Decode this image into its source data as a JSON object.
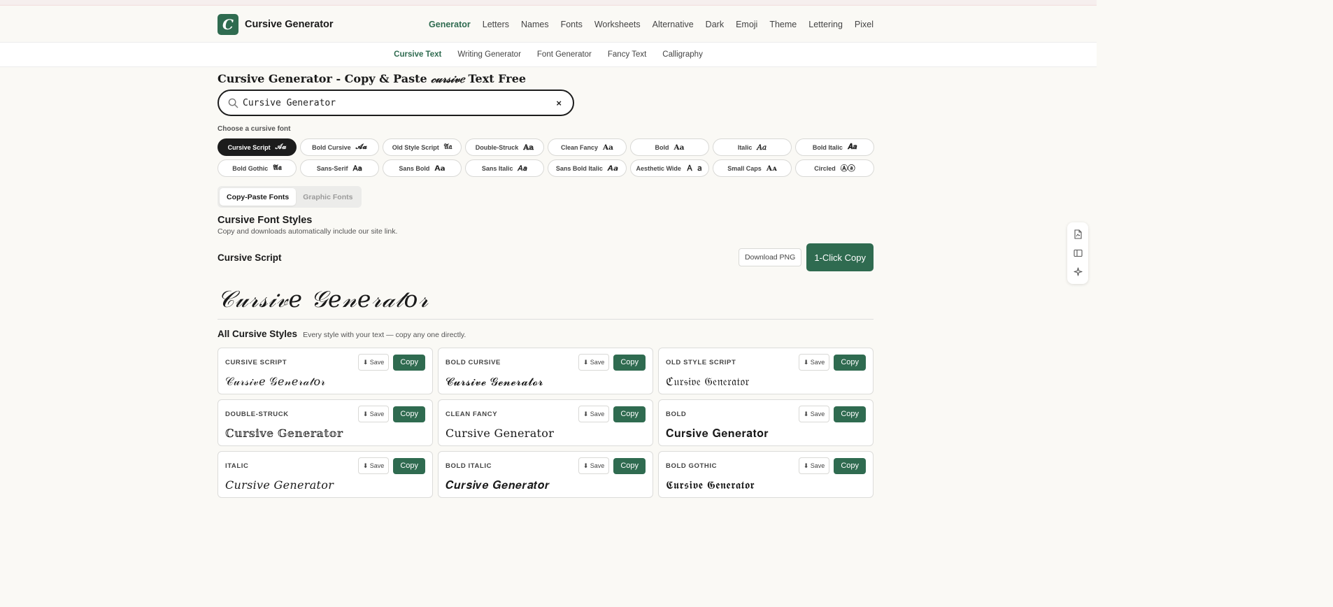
{
  "brand": {
    "logo_letter": "C",
    "name": "Cursive Generator"
  },
  "nav": [
    "Generator",
    "Letters",
    "Names",
    "Fonts",
    "Worksheets",
    "Alternative",
    "Dark",
    "Emoji",
    "Theme",
    "Lettering",
    "Pixel"
  ],
  "subnav": [
    "Cursive Text",
    "Writing Generator",
    "Font Generator",
    "Fancy Text",
    "Calligraphy"
  ],
  "page_title": {
    "before": "Cursive Generator - Copy & Paste ",
    "accent": "𝒸𝓊𝓇𝓈𝒾𝓋𝑒",
    "after": " Text Free"
  },
  "search": {
    "value": "Cursive Generator",
    "clear": "×"
  },
  "choose_label": "Choose a cursive font",
  "fonts": [
    {
      "label": "Cursive Script",
      "sample": "𝒜𝒶"
    },
    {
      "label": "Bold Cursive",
      "sample": "𝓐𝓪"
    },
    {
      "label": "Old Style Script",
      "sample": "𝔄𝔞"
    },
    {
      "label": "Double-Struck",
      "sample": "𝔸𝕒"
    },
    {
      "label": "Clean Fancy",
      "sample": "Aa"
    },
    {
      "label": "Bold",
      "sample": "𝐀𝐚"
    },
    {
      "label": "Italic",
      "sample": "𝐴𝑎"
    },
    {
      "label": "Bold Italic",
      "sample": "𝑨𝒂"
    },
    {
      "label": "Bold Gothic",
      "sample": "𝕬𝖆"
    },
    {
      "label": "Sans-Serif",
      "sample": "𝖠𝖺"
    },
    {
      "label": "Sans Bold",
      "sample": "𝗔𝗮"
    },
    {
      "label": "Sans Italic",
      "sample": "𝘈𝘢"
    },
    {
      "label": "Sans Bold Italic",
      "sample": "𝘼𝙖"
    },
    {
      "label": "Aesthetic Wide",
      "sample": "Ａ ａ"
    },
    {
      "label": "Small Caps",
      "sample": "Aᴀ"
    },
    {
      "label": "Circled",
      "sample": "Ⓐⓐ"
    }
  ],
  "tabs": [
    "Copy-Paste Fonts",
    "Graphic Fonts"
  ],
  "section": {
    "title": "Cursive Font Styles",
    "note": "Copy and downloads automatically include our site link."
  },
  "current": {
    "name": "Cursive Script",
    "download_label": "Download PNG",
    "copy_label": "1-Click Copy",
    "preview": "𝒞𝓊𝓇𝓈𝒾𝓋𝑒 𝒢𝑒𝓃𝑒𝓇𝒶𝓉𝑜𝓇"
  },
  "all_styles": {
    "title": "All Cursive Styles",
    "note": "Every style with your text — copy any one directly."
  },
  "save_label": "⬇ Save",
  "copy_label": "Copy",
  "cards": [
    {
      "label": "CURSIVE SCRIPT",
      "text": "𝒞𝓊𝓇𝓈𝒾𝓋𝑒 𝒢𝑒𝓃𝑒𝓇𝒶𝓉𝑜𝓇"
    },
    {
      "label": "BOLD CURSIVE",
      "text": "𝓒𝓾𝓻𝓼𝓲𝓿𝓮 𝓖𝓮𝓷𝓮𝓻𝓪𝓽𝓸𝓻"
    },
    {
      "label": "OLD STYLE SCRIPT",
      "text": "ℭ𝔲𝔯𝔰𝔦𝔳𝔢 𝔊𝔢𝔫𝔢𝔯𝔞𝔱𝔬𝔯"
    },
    {
      "label": "DOUBLE-STRUCK",
      "text": "ℂ𝕦𝕣𝕤𝕚𝕧𝕖 𝔾𝕖𝕟𝕖𝕣𝕒𝕥𝕠𝕣"
    },
    {
      "label": "CLEAN FANCY",
      "text": "Cursive Generator"
    },
    {
      "label": "BOLD",
      "text": "𝐂𝐮𝐫𝐬𝐢𝐯𝐞 𝐆𝐞𝐧𝐞𝐫𝐚𝐭𝐨𝐫"
    },
    {
      "label": "ITALIC",
      "text": "𝐶𝑢𝑟𝑠𝑖𝑣𝑒 𝐺𝑒𝑛𝑒𝑟𝑎𝑡𝑜𝑟"
    },
    {
      "label": "BOLD ITALIC",
      "text": "𝑪𝒖𝒓𝒔𝒊𝒗𝒆 𝑮𝒆𝒏𝒆𝒓𝒂𝒕𝒐𝒓"
    },
    {
      "label": "BOLD GOTHIC",
      "text": "𝕮𝖚𝖗𝖘𝖎𝖛𝖊 𝕲𝖊𝖓𝖊𝖗𝖆𝖙𝖔𝖗"
    }
  ]
}
